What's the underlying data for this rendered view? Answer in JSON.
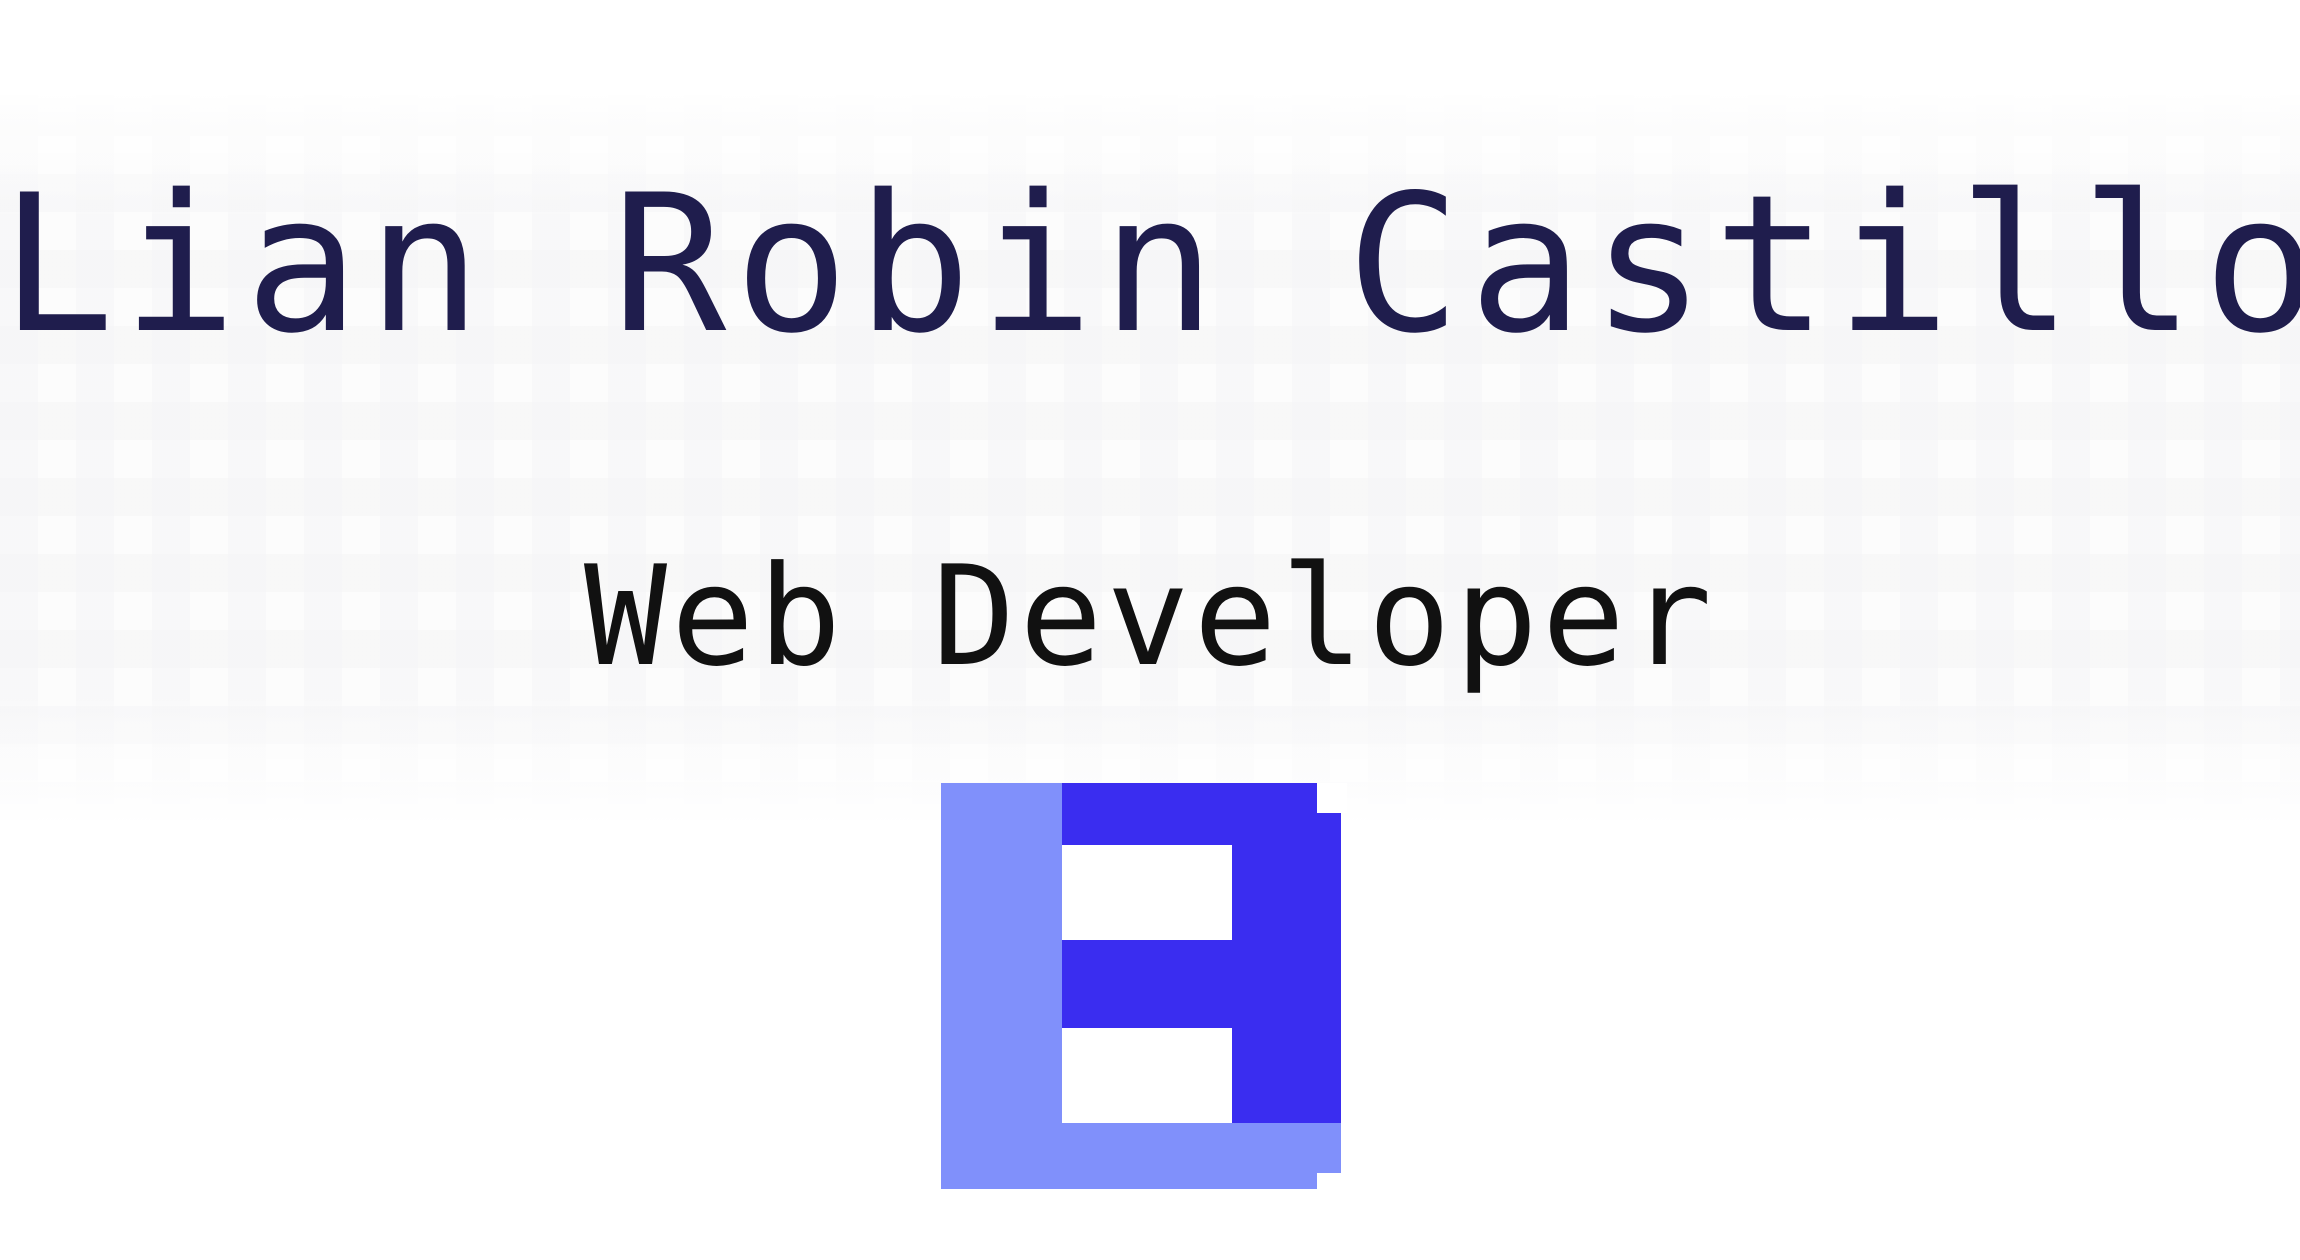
{
  "header": {
    "name": "Lian Robin Castillo",
    "title": "Web Developer"
  },
  "logo": {
    "icon": "pixel-b-logo-icon",
    "colors": {
      "light": "#8090fb",
      "dark": "#3a2df0",
      "white": "#ffffff"
    }
  },
  "colors": {
    "name": "#1f1d4d",
    "title": "#111111",
    "background": "#ffffff"
  }
}
